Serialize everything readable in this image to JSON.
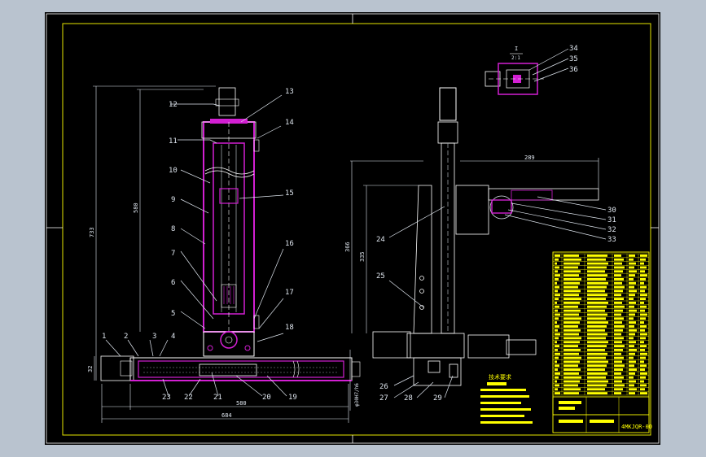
{
  "colors": {
    "background": "#b9c3cf",
    "paper": "#000000",
    "border": "#ffffff",
    "frame": "#e6e600",
    "outline": "#ffffff",
    "section": "#d21fd2",
    "leader": "#dfe6ef",
    "hatch": "#9aa0a6",
    "table": "#ffff00"
  },
  "balloons": {
    "n1": "1",
    "n2": "2",
    "n3": "3",
    "n4": "4",
    "n5": "5",
    "n6": "6",
    "n7": "7",
    "n8": "8",
    "n9": "9",
    "n10": "10",
    "n11": "11",
    "n12": "12",
    "n13": "13",
    "n14": "14",
    "n15": "15",
    "n16": "16",
    "n17": "17",
    "n18": "18",
    "n19": "19",
    "n20": "20",
    "n21": "21",
    "n22": "22",
    "n23": "23",
    "n24": "24",
    "n25": "25",
    "n26": "26",
    "n27": "27",
    "n28": "28",
    "n29": "29",
    "n30": "30",
    "n31": "31",
    "n32": "32",
    "n33": "33",
    "n34": "34",
    "n35": "35",
    "n36": "36"
  },
  "dimensions": {
    "height_total": "733",
    "height_column": "580",
    "base_length": "580",
    "overall_length": "684",
    "side_height": "366",
    "side_inner": "335",
    "arm_reach": "289",
    "foot": "32",
    "bore": "φ30H7/h6"
  },
  "detail_label": {
    "letter": "I",
    "scale": "2:1"
  },
  "title_block": {
    "drawing_no": "4MKJQR-00"
  },
  "tech_notes": {
    "heading": "技术要求"
  }
}
